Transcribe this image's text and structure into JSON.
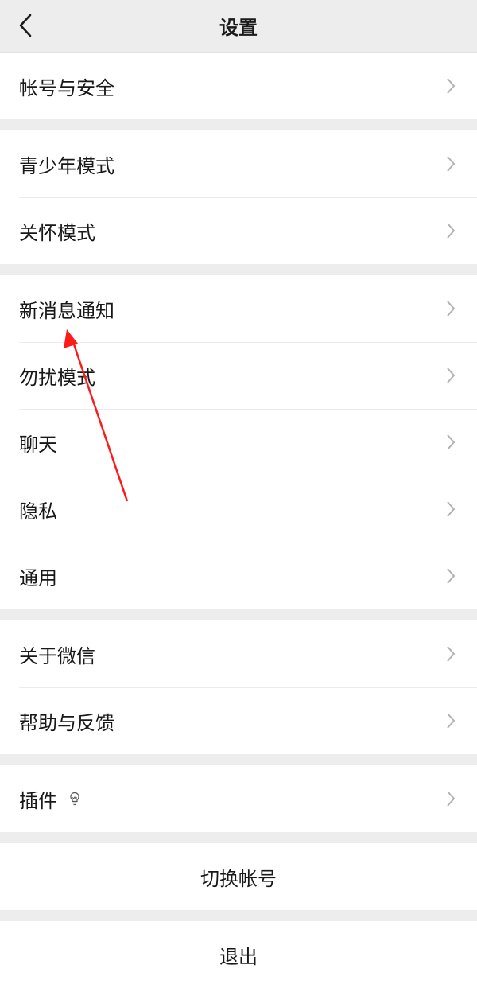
{
  "header": {
    "title": "设置",
    "back_icon": "chevron-left-icon"
  },
  "groups": [
    [
      "帐号与安全"
    ],
    [
      "青少年模式",
      "关怀模式"
    ],
    [
      "新消息通知",
      "勿扰模式",
      "聊天",
      "隐私",
      "通用"
    ],
    [
      "关于微信",
      "帮助与反馈"
    ],
    [
      "插件"
    ]
  ],
  "plugin_icon": "lightbulb-icon",
  "actions": {
    "switch_account": "切换帐号",
    "logout": "退出"
  },
  "annotation": {
    "color": "#ff1a1a",
    "icon": "red-arrow-annotation"
  }
}
